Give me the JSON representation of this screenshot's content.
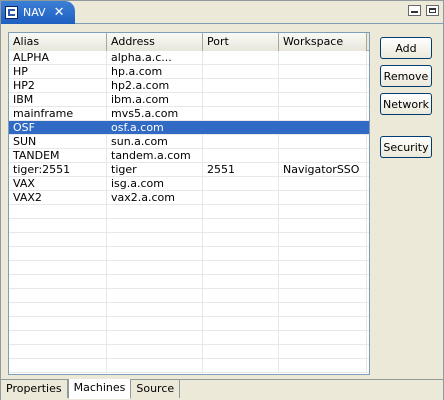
{
  "view": {
    "title": "NAV",
    "icon": "navigator-view-icon"
  },
  "table": {
    "columns": [
      "Alias",
      "Address",
      "Port",
      "Workspace"
    ],
    "rows": [
      [
        "ALPHA",
        "alpha.a.c...",
        "",
        ""
      ],
      [
        "HP",
        "hp.a.com",
        "",
        ""
      ],
      [
        "HP2",
        "hp2.a.com",
        "",
        ""
      ],
      [
        "IBM",
        "ibm.a.com",
        "",
        ""
      ],
      [
        "mainframe",
        "mvs5.a.com",
        "",
        ""
      ],
      [
        "OSF",
        "osf.a.com",
        "",
        ""
      ],
      [
        "SUN",
        "sun.a.com",
        "",
        ""
      ],
      [
        "TANDEM",
        "tandem.a.com",
        "",
        ""
      ],
      [
        "tiger:2551",
        "tiger",
        "2551",
        "NavigatorSSO"
      ],
      [
        "VAX",
        "isg.a.com",
        "",
        ""
      ],
      [
        "VAX2",
        "vax2.a.com",
        "",
        ""
      ]
    ],
    "selected_row": 5,
    "selection_color": "#316ac5"
  },
  "buttons": {
    "add": "Add",
    "remove": "Remove",
    "network": "Network",
    "security": "Security"
  },
  "bottom_tabs": {
    "items": [
      "Properties",
      "Machines",
      "Source"
    ],
    "active": "Machines"
  }
}
